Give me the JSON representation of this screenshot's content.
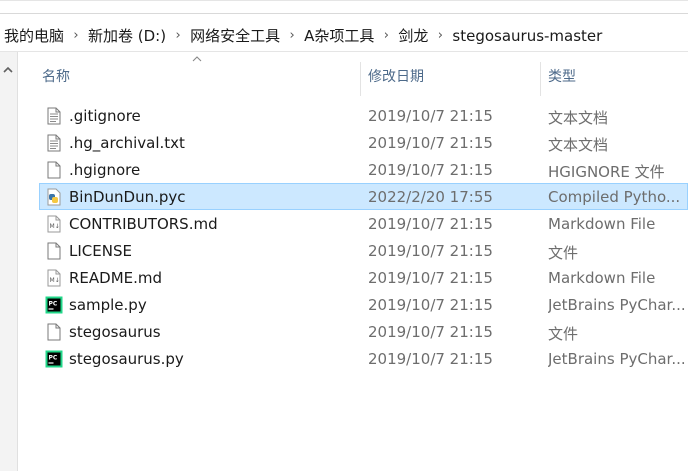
{
  "breadcrumb": [
    {
      "label": "我的电脑"
    },
    {
      "label": "新加卷 (D:)"
    },
    {
      "label": "网络安全工具"
    },
    {
      "label": "A杂项工具"
    },
    {
      "label": "剑龙"
    },
    {
      "label": "stegosaurus-master"
    }
  ],
  "columns": {
    "name": "名称",
    "date": "修改日期",
    "type": "类型"
  },
  "files": [
    {
      "name": ".gitignore",
      "date": "2019/10/7 21:15",
      "type": "文本文档",
      "icon": "text-file-icon",
      "selected": false
    },
    {
      "name": ".hg_archival.txt",
      "date": "2019/10/7 21:15",
      "type": "文本文档",
      "icon": "text-file-icon",
      "selected": false
    },
    {
      "name": ".hgignore",
      "date": "2019/10/7 21:15",
      "type": "HGIGNORE 文件",
      "icon": "blank-file-icon",
      "selected": false
    },
    {
      "name": "BinDunDun.pyc",
      "date": "2022/2/20 17:55",
      "type": "Compiled Pytho...",
      "icon": "python-compiled-icon",
      "selected": true
    },
    {
      "name": "CONTRIBUTORS.md",
      "date": "2019/10/7 21:15",
      "type": "Markdown File",
      "icon": "markdown-file-icon",
      "selected": false
    },
    {
      "name": "LICENSE",
      "date": "2019/10/7 21:15",
      "type": "文件",
      "icon": "blank-file-icon",
      "selected": false
    },
    {
      "name": "README.md",
      "date": "2019/10/7 21:15",
      "type": "Markdown File",
      "icon": "markdown-file-icon",
      "selected": false
    },
    {
      "name": "sample.py",
      "date": "2019/10/7 21:15",
      "type": "JetBrains PyChar...",
      "icon": "pycharm-file-icon",
      "selected": false
    },
    {
      "name": "stegosaurus",
      "date": "2019/10/7 21:15",
      "type": "文件",
      "icon": "blank-file-icon",
      "selected": false
    },
    {
      "name": "stegosaurus.py",
      "date": "2019/10/7 21:15",
      "type": "JetBrains PyChar...",
      "icon": "pycharm-file-icon",
      "selected": false
    }
  ],
  "colors": {
    "selection_bg": "#cce8ff",
    "selection_border": "#99d1ff",
    "header_text": "#4d6a8a",
    "meta_text": "#6d6d6d"
  }
}
